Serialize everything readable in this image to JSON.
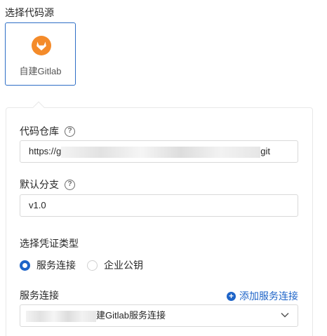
{
  "source": {
    "title": "选择代码源",
    "card_label": "自建Gitlab",
    "icon": "gitlab-icon"
  },
  "repo": {
    "label": "代码仓库",
    "url_prefix": "https://g",
    "url_suffix": "git"
  },
  "branch": {
    "label": "默认分支",
    "value": "v1.0"
  },
  "credential": {
    "label": "选择凭证类型",
    "options": [
      "服务连接",
      "企业公钥"
    ],
    "selected": "服务连接"
  },
  "service": {
    "label": "服务连接",
    "add_link": "添加服务连接",
    "selected_suffix": "建Gitlab服务连接"
  },
  "colors": {
    "accent": "#1e64c8",
    "gitlab_orange": "#f48b2a"
  }
}
